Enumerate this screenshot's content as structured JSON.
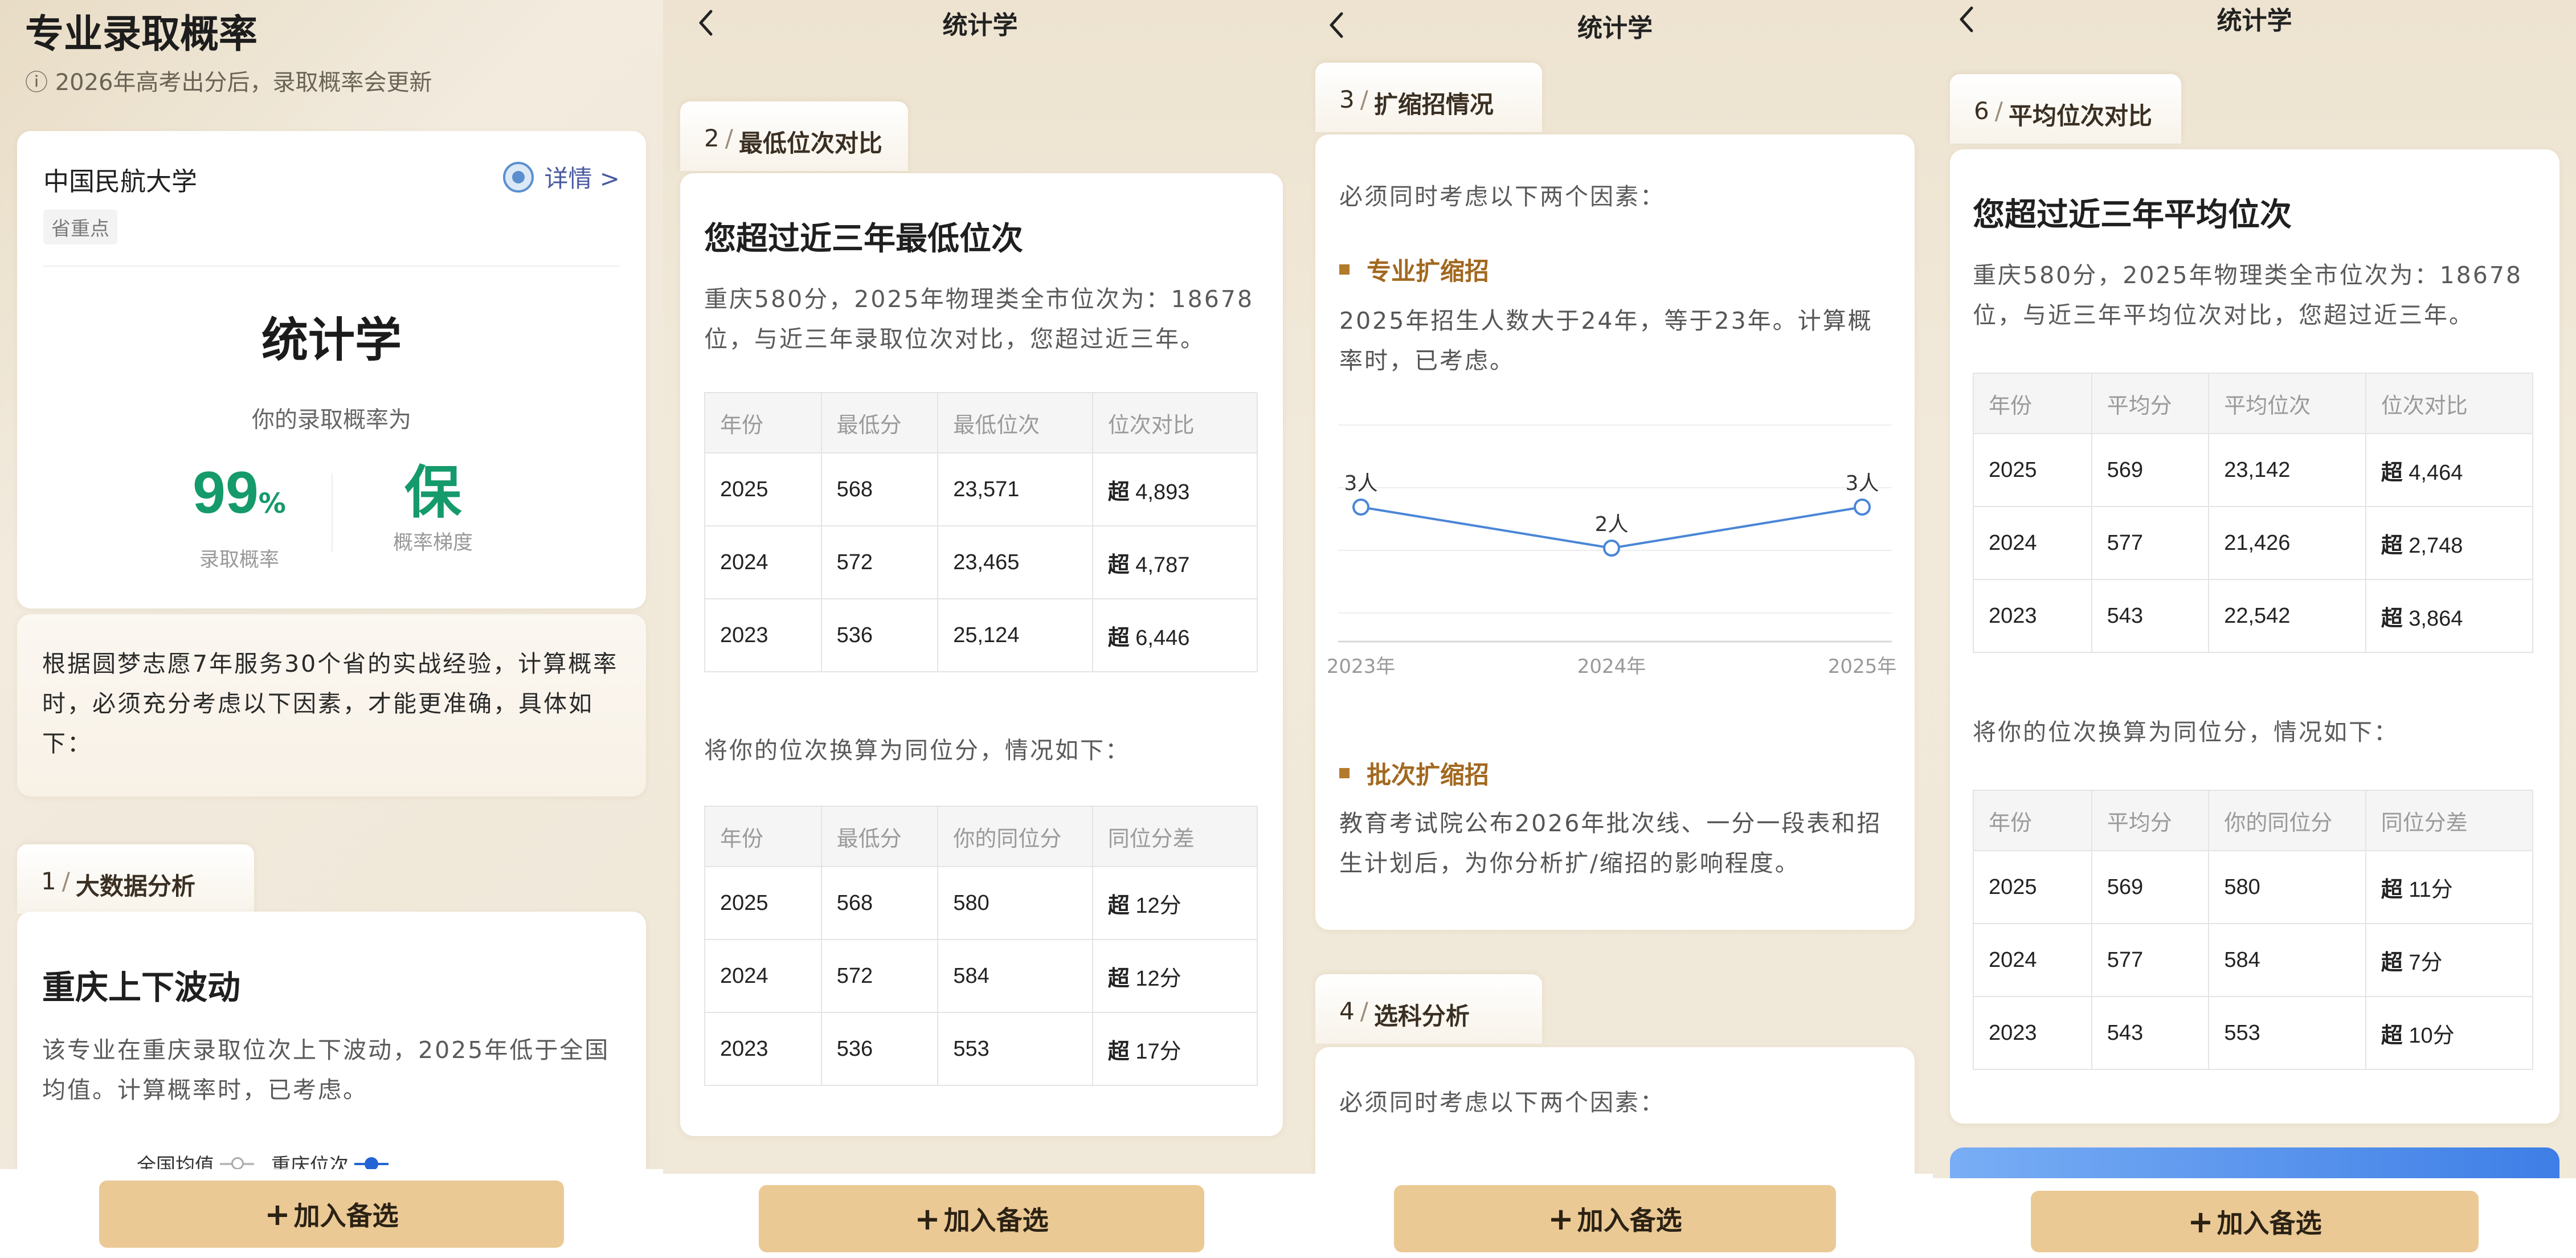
{
  "panel1": {
    "header_title": "专业录取概率",
    "header_notice": "ⓘ 2026年高考出分后，录取概率会更新",
    "school_name": "中国民航大学",
    "detail_link": "详情 >",
    "school_tag": "省重点",
    "major": "统计学",
    "prob_label": "你的录取概率为",
    "prob_value": "99",
    "prob_unit": "%",
    "prob_caption": "录取概率",
    "level_value": "保",
    "level_caption": "概率梯度",
    "intro_text": "根据圆梦志愿7年服务30个省的实战经验，计算概率时，必须充分考虑以下因素，才能更准确，具体如下：",
    "section_num": "1",
    "section_name": "大数据分析",
    "block_title": "重庆上下波动",
    "block_text": "该专业在重庆录取位次上下波动，2025年低于全国均值。计算概率时，已考虑。",
    "legend_national": "全国均值",
    "legend_chongqing": "重庆位次",
    "add_button": "加入备选"
  },
  "panel2": {
    "nav_title": "统计学",
    "section_num": "2",
    "section_name": "最低位次对比",
    "title": "您超过近三年最低位次",
    "text": "重庆580分，2025年物理类全市位次为：18678位，与近三年录取位次对比，您超过近三年。",
    "table1_headers": [
      "年份",
      "最低分",
      "最低位次",
      "位次对比"
    ],
    "table1_rows": [
      [
        "2025",
        "568",
        "23,571",
        "超",
        "4,893"
      ],
      [
        "2024",
        "572",
        "23,465",
        "超",
        "4,787"
      ],
      [
        "2023",
        "536",
        "25,124",
        "超",
        "6,446"
      ]
    ],
    "convert_text": "将你的位次换算为同位分，情况如下：",
    "table2_headers": [
      "年份",
      "最低分",
      "你的同位分",
      "同位分差"
    ],
    "table2_rows": [
      [
        "2025",
        "568",
        "580",
        "超",
        "12分"
      ],
      [
        "2024",
        "572",
        "584",
        "超",
        "12分"
      ],
      [
        "2023",
        "536",
        "553",
        "超",
        "17分"
      ]
    ],
    "add_button": "加入备选"
  },
  "panel3": {
    "nav_title": "统计学",
    "section_num": "3",
    "section_name": "扩缩招情况",
    "lead": "必须同时考虑以下两个因素：",
    "factor1_title": "专业扩缩招",
    "factor1_text": "2025年招生人数大于24年，等于23年。计算概率时，已考虑。",
    "factor2_title": "批次扩缩招",
    "factor2_text": "教育考试院公布2026年批次线、一分一段表和招生计划后，为你分析扩/缩招的影响程度。",
    "section4_num": "4",
    "section4_name": "选科分析",
    "section4_lead": "必须同时考虑以下两个因素：",
    "add_button": "加入备选"
  },
  "panel4": {
    "nav_title": "统计学",
    "section_num": "6",
    "section_name": "平均位次对比",
    "title": "您超过近三年平均位次",
    "text": "重庆580分，2025年物理类全市位次为：18678位，与近三年平均位次对比，您超过近三年。",
    "table1_headers": [
      "年份",
      "平均分",
      "平均位次",
      "位次对比"
    ],
    "table1_rows": [
      [
        "2025",
        "569",
        "23,142",
        "超",
        "4,464"
      ],
      [
        "2024",
        "577",
        "21,426",
        "超",
        "2,748"
      ],
      [
        "2023",
        "543",
        "22,542",
        "超",
        "3,864"
      ]
    ],
    "convert_text": "将你的位次换算为同位分，情况如下：",
    "table2_headers": [
      "年份",
      "平均分",
      "你的同位分",
      "同位分差"
    ],
    "table2_rows": [
      [
        "2025",
        "569",
        "580",
        "超",
        "11分"
      ],
      [
        "2024",
        "577",
        "584",
        "超",
        "7分"
      ],
      [
        "2023",
        "543",
        "553",
        "超",
        "10分"
      ]
    ],
    "add_button": "加入备选"
  },
  "chart_data": {
    "type": "line",
    "categories": [
      "2023年",
      "2024年",
      "2025年"
    ],
    "series": [
      {
        "values": [
          3,
          2,
          3
        ]
      }
    ],
    "data_labels": [
      "3人",
      "2人",
      "3人"
    ],
    "color": "#4a86d6",
    "grid": true
  }
}
